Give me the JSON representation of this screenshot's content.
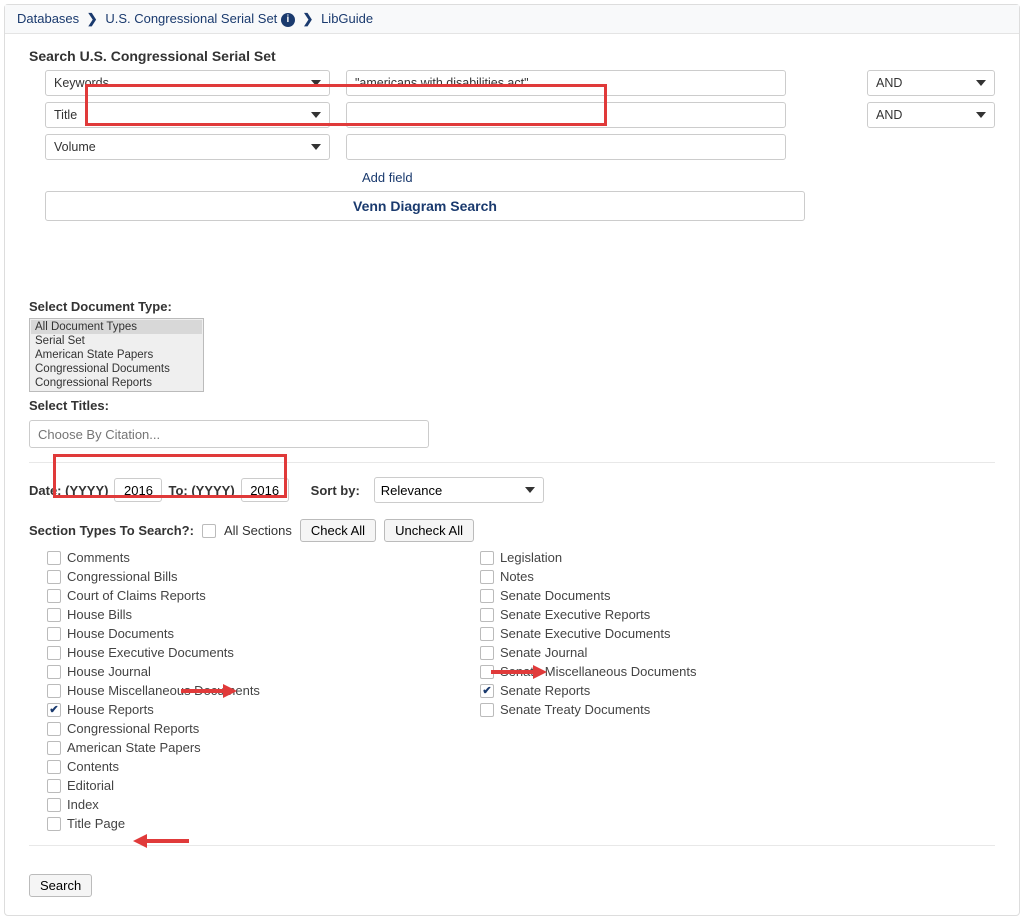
{
  "breadcrumb": {
    "databases": "Databases",
    "serial_set": "U.S. Congressional Serial Set",
    "libguide": "LibGuide"
  },
  "search": {
    "heading": "Search U.S. Congressional Serial Set",
    "rows": [
      {
        "field": "Keywords",
        "term": "\"americans with disabilities act\"",
        "op": "AND"
      },
      {
        "field": "Title",
        "term": "",
        "op": "AND"
      },
      {
        "field": "Volume",
        "term": "",
        "op": ""
      }
    ],
    "add_field": "Add field",
    "venn": "Venn Diagram Search"
  },
  "doc_type": {
    "label": "Select Document Type:",
    "options": [
      "All Document Types",
      "Serial Set",
      "American State Papers",
      "Congressional Documents",
      "Congressional Reports"
    ],
    "selected": "All Document Types"
  },
  "titles": {
    "label": "Select Titles:",
    "placeholder": "Choose By Citation..."
  },
  "date": {
    "label": "Date: (YYYY)",
    "to_label": "To: (YYYY)",
    "from": "2016",
    "to": "2016",
    "sort_label": "Sort by:",
    "sort_value": "Relevance"
  },
  "sections": {
    "label": "Section Types To Search?:",
    "all_label": "All Sections",
    "check_all": "Check All",
    "uncheck_all": "Uncheck All",
    "left": [
      {
        "label": "Comments",
        "checked": false
      },
      {
        "label": "Congressional Bills",
        "checked": false
      },
      {
        "label": "Court of Claims Reports",
        "checked": false
      },
      {
        "label": "House Bills",
        "checked": false
      },
      {
        "label": "House Documents",
        "checked": false
      },
      {
        "label": "House Executive Documents",
        "checked": false
      },
      {
        "label": "House Journal",
        "checked": false
      },
      {
        "label": "House Miscellaneous Documents",
        "checked": false
      },
      {
        "label": "House Reports",
        "checked": true
      },
      {
        "label": "Congressional Reports",
        "checked": false
      },
      {
        "label": "American State Papers",
        "checked": false
      },
      {
        "label": "Contents",
        "checked": false
      },
      {
        "label": "Editorial",
        "checked": false
      },
      {
        "label": "Index",
        "checked": false
      },
      {
        "label": "Title Page",
        "checked": false
      }
    ],
    "right": [
      {
        "label": "Legislation",
        "checked": false
      },
      {
        "label": "Notes",
        "checked": false
      },
      {
        "label": "Senate Documents",
        "checked": false
      },
      {
        "label": "Senate Executive Reports",
        "checked": false
      },
      {
        "label": "Senate Executive Documents",
        "checked": false
      },
      {
        "label": "Senate Journal",
        "checked": false
      },
      {
        "label": "Senate Miscellaneous Documents",
        "checked": false
      },
      {
        "label": "Senate Reports",
        "checked": true
      },
      {
        "label": "Senate Treaty Documents",
        "checked": false
      }
    ]
  },
  "search_button": "Search"
}
